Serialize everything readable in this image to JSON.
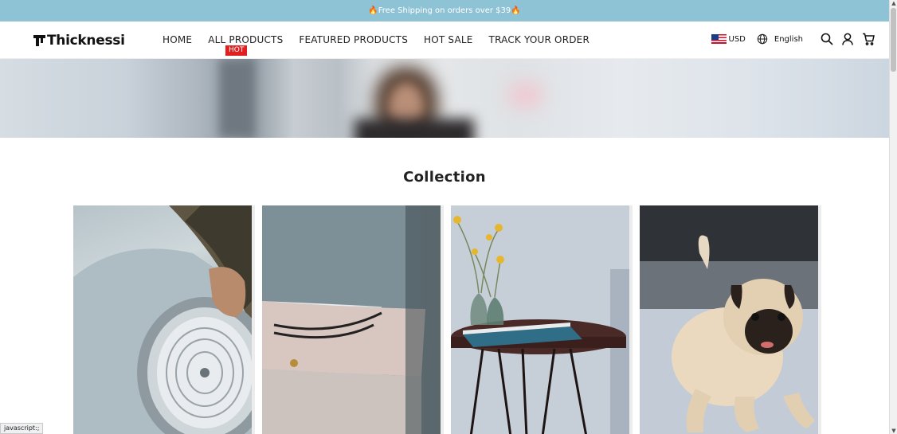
{
  "announcement": {
    "text": "Free Shipping on orders over $39",
    "emoji": "🔥"
  },
  "header": {
    "logo": "Thicknessi",
    "nav": [
      {
        "label": "HOME"
      },
      {
        "label": "ALL PRODUCTS"
      },
      {
        "label": "FEATURED PRODUCTS"
      },
      {
        "label": "HOT SALE"
      },
      {
        "label": "TRACK YOUR ORDER"
      }
    ],
    "hot_badge": "HOT",
    "currency": "USD",
    "language": "English",
    "icons": [
      "us-flag-icon",
      "globe-icon",
      "search-icon",
      "account-icon",
      "cart-icon"
    ]
  },
  "collection": {
    "title": "Collection",
    "cards": [
      {
        "name": "car-headlight-image"
      },
      {
        "name": "bracelet-wrist-image"
      },
      {
        "name": "side-table-vase-image"
      },
      {
        "name": "pug-dog-image"
      }
    ]
  },
  "status_bar": "javascript:;",
  "colors": {
    "announce_bg": "#8ec3d6",
    "hot_badge": "#e02020"
  }
}
